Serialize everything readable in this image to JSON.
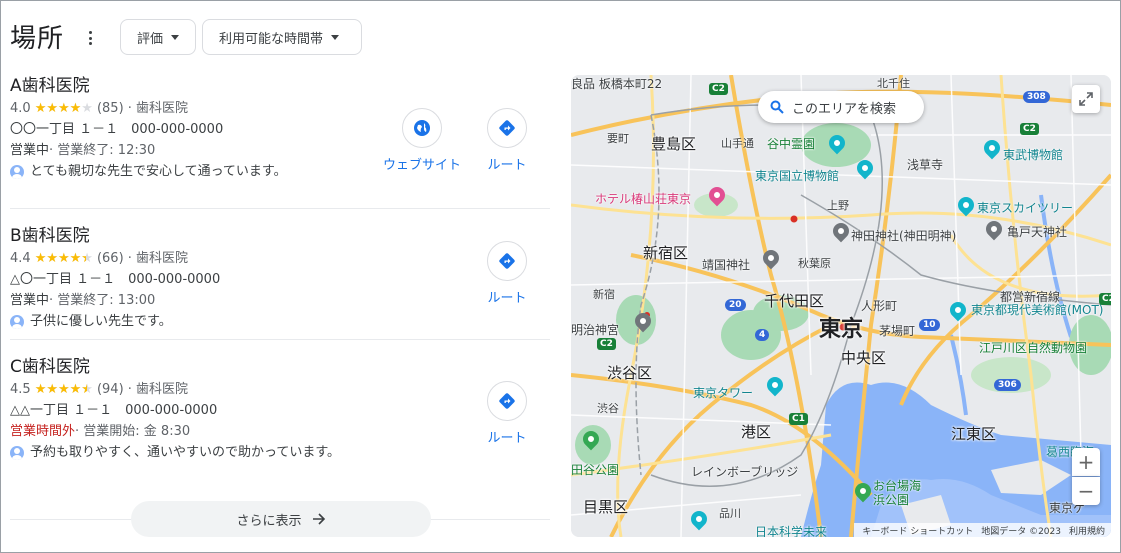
{
  "header": {
    "title": "場所",
    "filters": [
      {
        "label": "評価"
      },
      {
        "label": "利用可能な時間帯"
      }
    ]
  },
  "listings": [
    {
      "name": "A歯科医院",
      "rating": "4.0",
      "rating_value": 4.0,
      "reviews": "(85)",
      "category": "· 歯科医院",
      "address": "〇〇一丁目 １－１　000-000-0000",
      "status": "営業中",
      "hours": " · 営業終了: 12:30",
      "review": "とても親切な先生で安心して通っています。",
      "website_label": "ウェブサイト",
      "route_label": "ルート"
    },
    {
      "name": "B歯科医院",
      "rating": "4.4",
      "rating_value": 4.4,
      "reviews": "(66)",
      "category": "· 歯科医院",
      "address": "△〇一丁目 １－１　000-000-0000",
      "status": "営業中",
      "hours": " · 営業終了: 13:00",
      "review": "子供に優しい先生です。",
      "route_label": "ルート"
    },
    {
      "name": "C歯科医院",
      "rating": "4.5",
      "rating_value": 4.5,
      "reviews": "(94)",
      "category": "· 歯科医院",
      "address": "△△一丁目 １－１　000-000-0000",
      "status": "営業時間外",
      "hours": " · 営業開始: 金 8:30",
      "review": "予約も取りやすく、通いやすいので助かっています。",
      "route_label": "ルート"
    }
  ],
  "more_button": "さらに表示",
  "map": {
    "search_label": "このエリアを検索",
    "attribution": {
      "shortcuts": "キーボード ショートカット",
      "data": "地図データ ©2023",
      "terms": "利用規約"
    },
    "labels": {
      "toshima": "豊島区",
      "shinjuku": "新宿区",
      "chiyoda": "千代田区",
      "tokyo": "東京",
      "chuo": "中央区",
      "shibuya": "渋谷区",
      "minato": "港区",
      "koto": "江東区",
      "meguro": "目黒区",
      "itabashi": "良品 板橋本町22",
      "yanaka": "谷中霊園",
      "kokuritsu": "東京国立博物館",
      "hakubutsukan": "東武博物館",
      "asakusa": "浅草寺",
      "chinzanso": "ホテル椿山荘東京",
      "skytree": "東京スカイツリー",
      "kanda": "神田神社(神田明神)",
      "kameido": "亀戸天神社",
      "yasukuni": "靖国神社",
      "akihabara": "秋葉原",
      "ueno": "上野",
      "ningyocho": "人形町",
      "shinjuku_st": "新宿",
      "meiji": "明治神宮",
      "kayabacho": "茅場町",
      "toei": "都営新宿線",
      "mot": "東京都現代美術館(MOT)",
      "edogawa": "江戸川区自然動物園",
      "tower": "東京タワー",
      "shibuya_st": "渋谷",
      "rainbow": "レインボーブリッジ",
      "odaiba": "お台場海浜公園",
      "setagaya": "田谷公園",
      "shinagawa": "品川",
      "miraikan": "日本科学未来",
      "kasai": "葛西臨海",
      "tokyo_gate": "東京ゲ",
      "kitasenju": "北千住",
      "komagome": "要町",
      "yamanote": "山手通"
    }
  }
}
